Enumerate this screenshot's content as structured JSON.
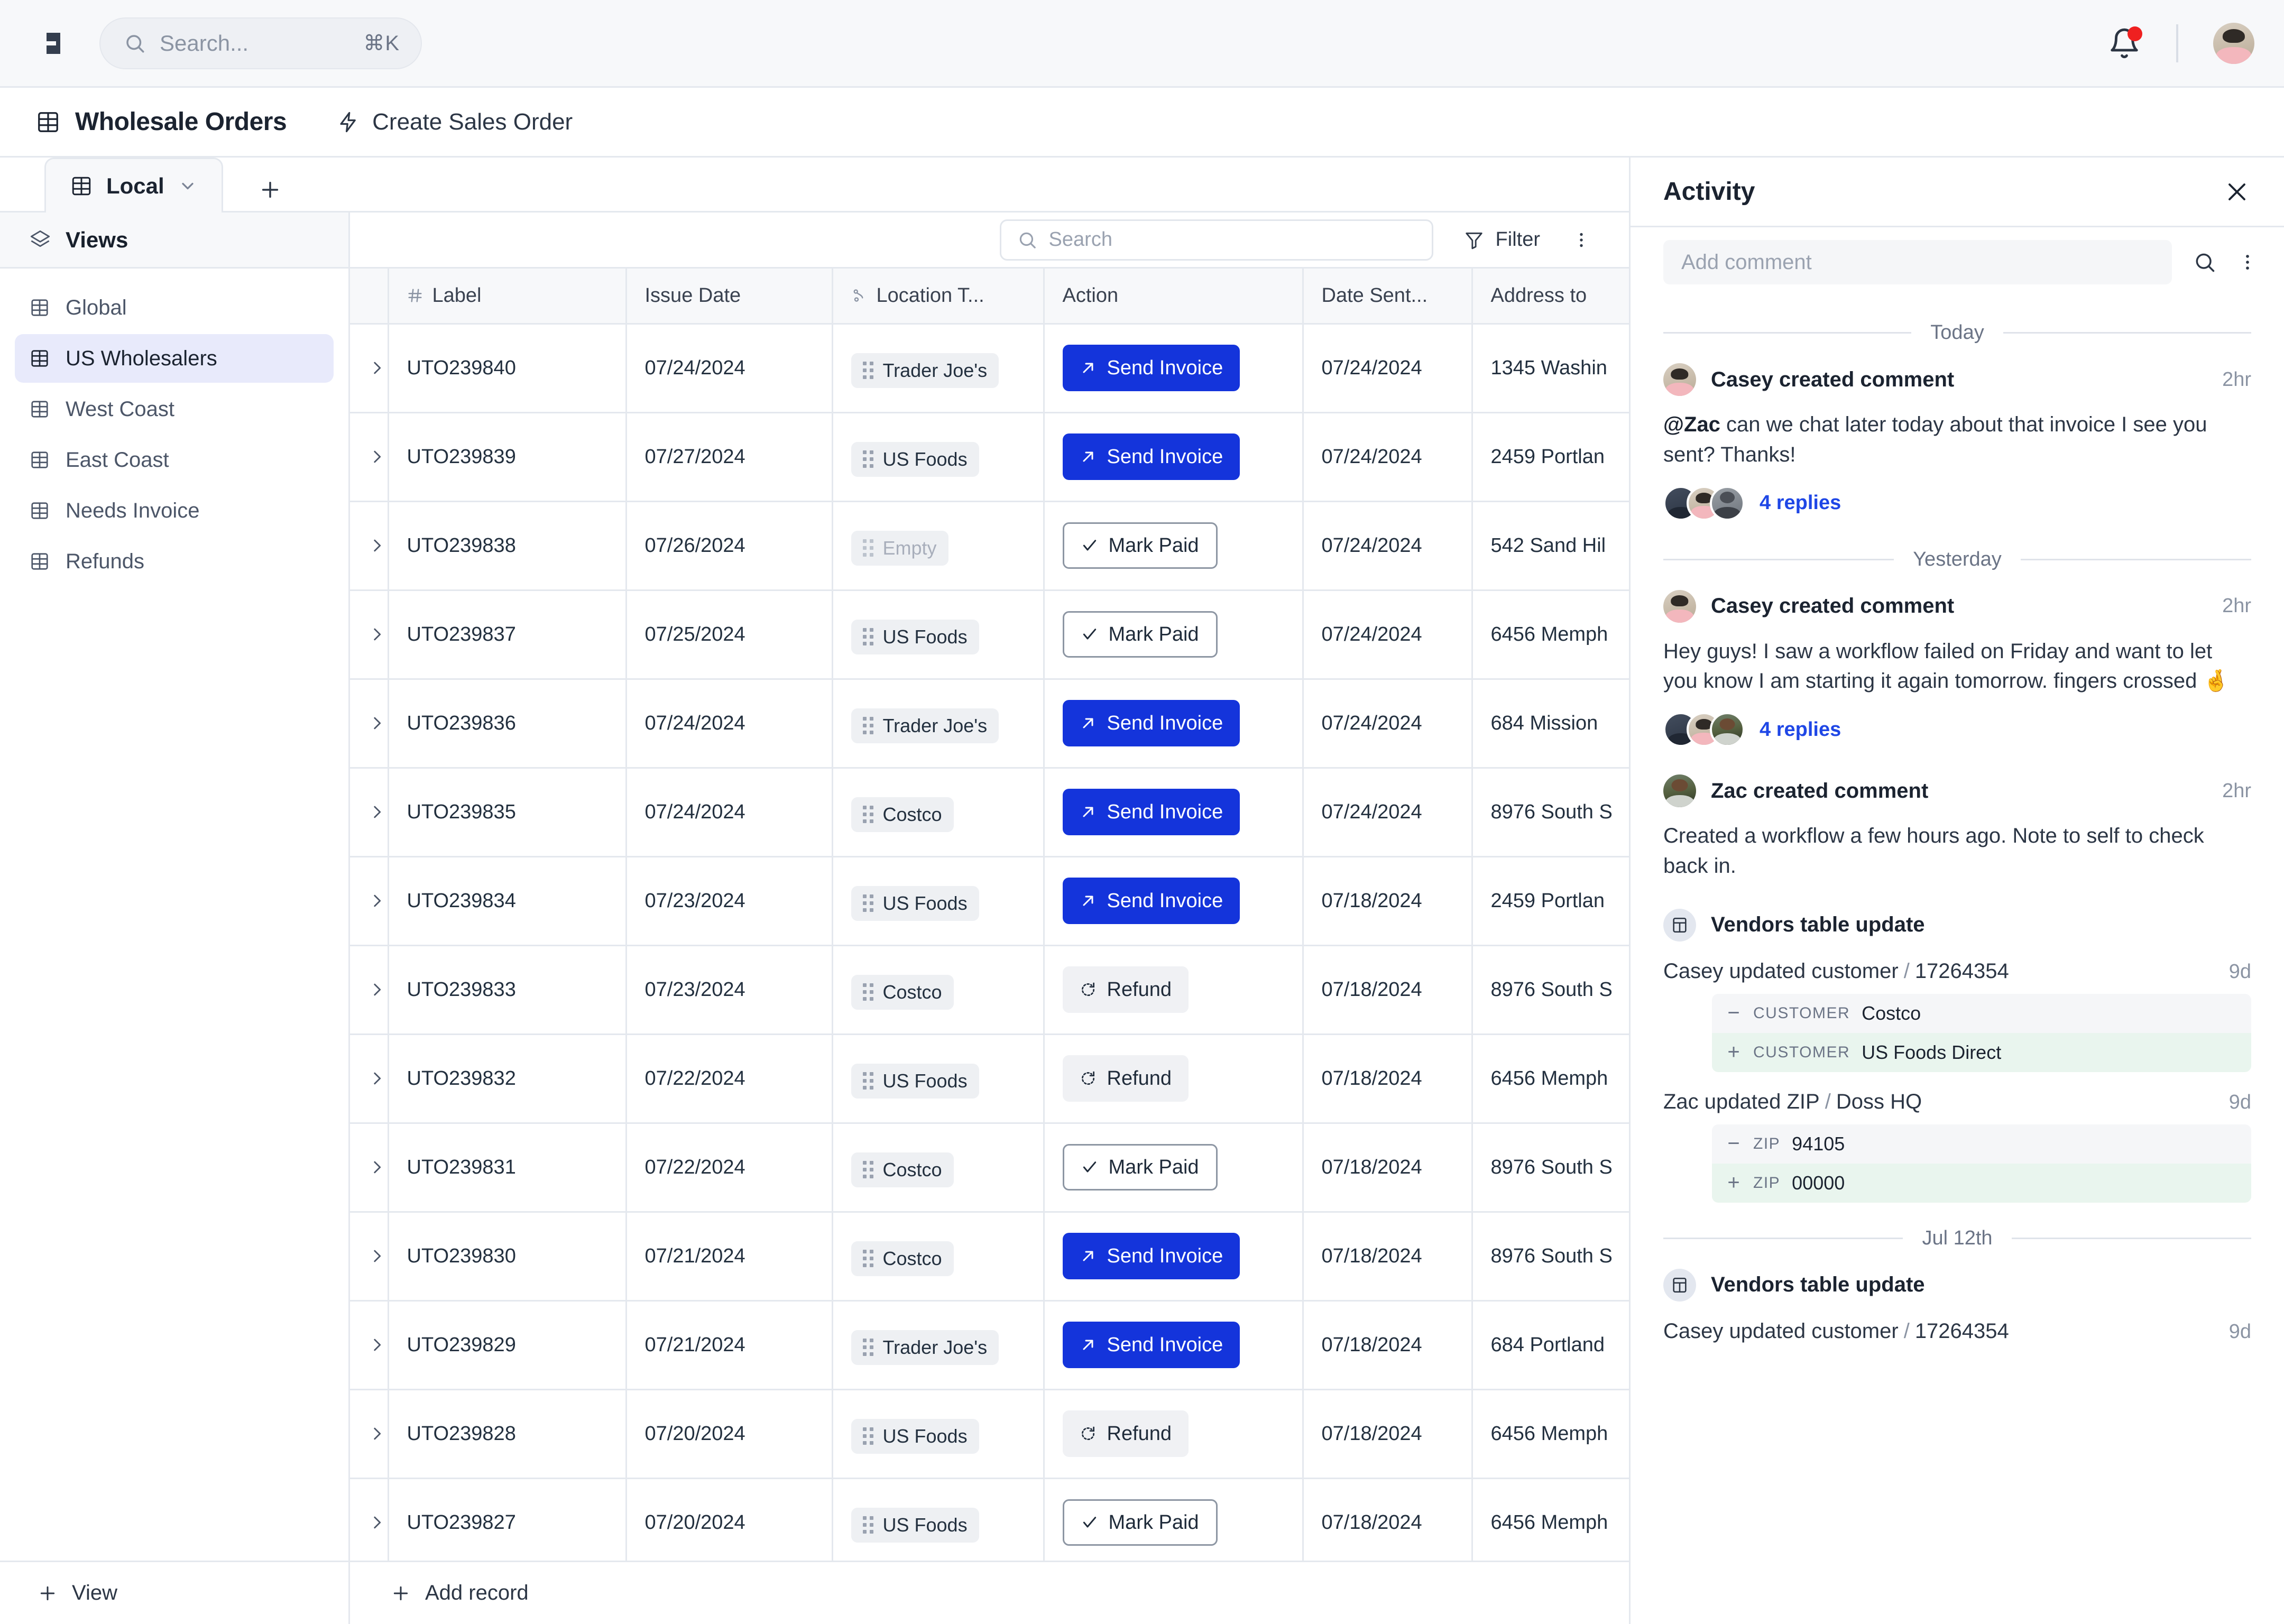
{
  "topbar": {
    "logo_name": "doss-logo",
    "search": {
      "placeholder": "Search...",
      "shortcut": "⌘K"
    },
    "notifications_label": "Notifications",
    "avatar_label": "Casey"
  },
  "workspace": {
    "title": "Wholesale Orders",
    "action_label": "Create Sales Order"
  },
  "tabs": {
    "current": "Local",
    "add_label": "+"
  },
  "sidebar": {
    "header": "Views",
    "items": [
      {
        "label": "Global",
        "active": false
      },
      {
        "label": "US Wholesalers",
        "active": true
      },
      {
        "label": "West Coast",
        "active": false
      },
      {
        "label": "East Coast",
        "active": false
      },
      {
        "label": "Needs Invoice",
        "active": false
      },
      {
        "label": "Refunds",
        "active": false
      }
    ],
    "footer_label": "View"
  },
  "table_toolbar": {
    "search_placeholder": "Search",
    "filter_label": "Filter",
    "more_label": "More options"
  },
  "table": {
    "columns": [
      {
        "key": "row",
        "label": ""
      },
      {
        "key": "label",
        "label": "Label",
        "icon": "hash-icon"
      },
      {
        "key": "issue_date",
        "label": "Issue Date"
      },
      {
        "key": "location",
        "label": "Location T...",
        "icon": "relation-icon"
      },
      {
        "key": "action",
        "label": "Action"
      },
      {
        "key": "date_sent",
        "label": "Date Sent..."
      },
      {
        "key": "address",
        "label": "Address to"
      }
    ],
    "rows": [
      {
        "label": "UTO239840",
        "issue_date": "07/24/2024",
        "location": "Trader Joe's",
        "location_empty": false,
        "action": "Send Invoice",
        "action_type": "primary",
        "date_sent": "07/24/2024",
        "address": "1345 Washin"
      },
      {
        "label": "UTO239839",
        "issue_date": "07/27/2024",
        "location": "US Foods",
        "location_empty": false,
        "action": "Send Invoice",
        "action_type": "primary",
        "date_sent": "07/24/2024",
        "address": "2459 Portlan"
      },
      {
        "label": "UTO239838",
        "issue_date": "07/26/2024",
        "location": "Empty",
        "location_empty": true,
        "action": "Mark Paid",
        "action_type": "outline",
        "date_sent": "07/24/2024",
        "address": "542 Sand Hil"
      },
      {
        "label": "UTO239837",
        "issue_date": "07/25/2024",
        "location": "US Foods",
        "location_empty": false,
        "action": "Mark Paid",
        "action_type": "outline",
        "date_sent": "07/24/2024",
        "address": "6456 Memph"
      },
      {
        "label": "UTO239836",
        "issue_date": "07/24/2024",
        "location": "Trader Joe's",
        "location_empty": false,
        "action": "Send Invoice",
        "action_type": "primary",
        "date_sent": "07/24/2024",
        "address": "684 Mission"
      },
      {
        "label": "UTO239835",
        "issue_date": "07/24/2024",
        "location": "Costco",
        "location_empty": false,
        "action": "Send Invoice",
        "action_type": "primary",
        "date_sent": "07/24/2024",
        "address": "8976 South S"
      },
      {
        "label": "UTO239834",
        "issue_date": "07/23/2024",
        "location": "US Foods",
        "location_empty": false,
        "action": "Send Invoice",
        "action_type": "primary",
        "date_sent": "07/18/2024",
        "address": "2459 Portlan"
      },
      {
        "label": "UTO239833",
        "issue_date": "07/23/2024",
        "location": "Costco",
        "location_empty": false,
        "action": "Refund",
        "action_type": "ghost",
        "date_sent": "07/18/2024",
        "address": "8976 South S"
      },
      {
        "label": "UTO239832",
        "issue_date": "07/22/2024",
        "location": "US Foods",
        "location_empty": false,
        "action": "Refund",
        "action_type": "ghost",
        "date_sent": "07/18/2024",
        "address": "6456 Memph"
      },
      {
        "label": "UTO239831",
        "issue_date": "07/22/2024",
        "location": "Costco",
        "location_empty": false,
        "action": "Mark Paid",
        "action_type": "outline",
        "date_sent": "07/18/2024",
        "address": "8976 South S"
      },
      {
        "label": "UTO239830",
        "issue_date": "07/21/2024",
        "location": "Costco",
        "location_empty": false,
        "action": "Send Invoice",
        "action_type": "primary",
        "date_sent": "07/18/2024",
        "address": "8976 South S"
      },
      {
        "label": "UTO239829",
        "issue_date": "07/21/2024",
        "location": "Trader Joe's",
        "location_empty": false,
        "action": "Send Invoice",
        "action_type": "primary",
        "date_sent": "07/18/2024",
        "address": "684 Portland"
      },
      {
        "label": "UTO239828",
        "issue_date": "07/20/2024",
        "location": "US Foods",
        "location_empty": false,
        "action": "Refund",
        "action_type": "ghost",
        "date_sent": "07/18/2024",
        "address": "6456 Memph"
      },
      {
        "label": "UTO239827",
        "issue_date": "07/20/2024",
        "location": "US Foods",
        "location_empty": false,
        "action": "Mark Paid",
        "action_type": "outline",
        "date_sent": "07/18/2024",
        "address": "6456 Memph"
      }
    ],
    "add_record_label": "Add record"
  },
  "activity": {
    "title": "Activity",
    "close_label": "Close",
    "compose_placeholder": "Add comment",
    "search_label": "Search activity",
    "more_label": "More options",
    "groups": [
      {
        "day": "Today",
        "entries": [
          {
            "kind": "comment",
            "avatar": "casey",
            "name": "Casey created comment",
            "time": "2hr",
            "mention": "@Zac",
            "body": " can we chat later today about that invoice I see you sent? Thanks!",
            "replies_label": "4 replies",
            "reply_avatars": [
              "dark",
              "casey",
              "grey"
            ]
          }
        ]
      },
      {
        "day": "Yesterday",
        "entries": [
          {
            "kind": "comment",
            "avatar": "casey",
            "name": "Casey created comment",
            "time": "2hr",
            "mention": "",
            "body": "Hey guys! I saw a workflow failed on Friday and want to let you know I am starting it again tomorrow. fingers crossed 🤞",
            "replies_label": "4 replies",
            "reply_avatars": [
              "dark",
              "casey",
              "zac"
            ]
          },
          {
            "kind": "comment",
            "avatar": "zac",
            "name": "Zac created comment",
            "time": "2hr",
            "mention": "",
            "body": "Created a workflow a few hours ago. Note to self to check back in.",
            "replies_label": "",
            "reply_avatars": []
          },
          {
            "kind": "system",
            "title": "Vendors table update",
            "changes": [
              {
                "actor": "Casey updated customer",
                "sep": "/",
                "record": "17264354",
                "age": "9d",
                "diff": [
                  {
                    "sign": "−",
                    "type": "minus",
                    "key": "CUSTOMER",
                    "value": "Costco"
                  },
                  {
                    "sign": "+",
                    "type": "plus",
                    "key": "CUSTOMER",
                    "value": "US Foods Direct"
                  }
                ]
              },
              {
                "actor": "Zac updated ZIP",
                "sep": "/",
                "record": "Doss HQ",
                "age": "9d",
                "diff": [
                  {
                    "sign": "−",
                    "type": "minus",
                    "key": "ZIP",
                    "value": "94105"
                  },
                  {
                    "sign": "+",
                    "type": "plus",
                    "key": "ZIP",
                    "value": "00000"
                  }
                ]
              }
            ]
          }
        ]
      },
      {
        "day": "Jul 12th",
        "entries": [
          {
            "kind": "system",
            "title": "Vendors table update",
            "changes": [
              {
                "actor": "Casey updated customer",
                "sep": "/",
                "record": "17264354",
                "age": "9d",
                "diff": []
              }
            ]
          }
        ]
      }
    ]
  },
  "colors": {
    "accent_blue": "#1434db",
    "link_blue": "#1f47e6",
    "notification_red": "#ef2020",
    "sidebar_active": "#e8eafb",
    "diff_plus_bg": "#e9f5ee",
    "border": "#e4e8ee"
  }
}
